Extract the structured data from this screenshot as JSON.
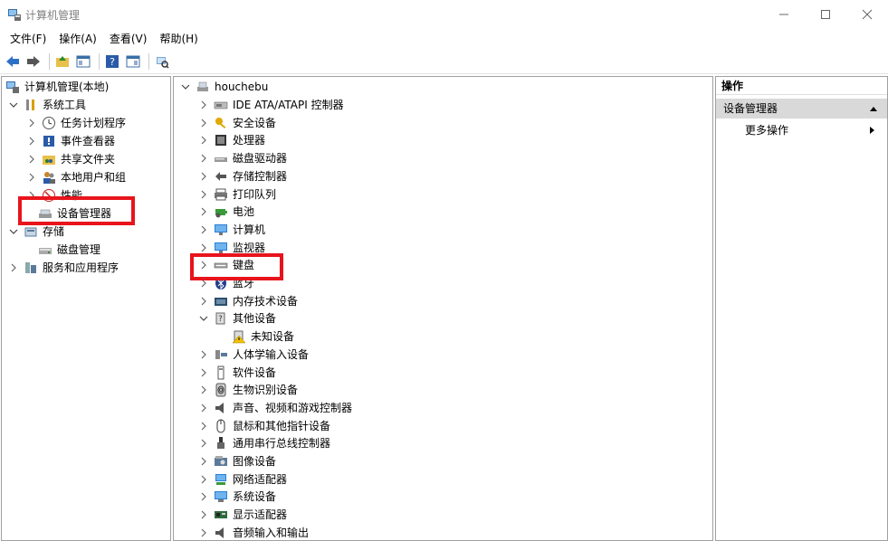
{
  "window": {
    "title": "计算机管理"
  },
  "menu": [
    "文件(F)",
    "操作(A)",
    "查看(V)",
    "帮助(H)"
  ],
  "left_tree": [
    {
      "label": "计算机管理(本地)",
      "level": 0,
      "expander": "",
      "icon": "computer-management-icon"
    },
    {
      "label": "系统工具",
      "level": 1,
      "expander": "expanded",
      "icon": "tools-icon"
    },
    {
      "label": "任务计划程序",
      "level": 2,
      "expander": "collapsed",
      "icon": "clock-icon"
    },
    {
      "label": "事件查看器",
      "level": 2,
      "expander": "collapsed",
      "icon": "event-viewer-icon"
    },
    {
      "label": "共享文件夹",
      "level": 2,
      "expander": "collapsed",
      "icon": "shared-folder-icon"
    },
    {
      "label": "本地用户和组",
      "level": 2,
      "expander": "collapsed",
      "icon": "users-icon"
    },
    {
      "label": "性能",
      "level": 2,
      "expander": "collapsed",
      "icon": "performance-icon"
    },
    {
      "label": "设备管理器",
      "level": 2,
      "expander": "",
      "icon": "device-manager-icon"
    },
    {
      "label": "存储",
      "level": 1,
      "expander": "expanded",
      "icon": "storage-icon"
    },
    {
      "label": "磁盘管理",
      "level": 2,
      "expander": "",
      "icon": "disk-management-icon"
    },
    {
      "label": "服务和应用程序",
      "level": 1,
      "expander": "collapsed",
      "icon": "services-icon"
    }
  ],
  "device_tree": [
    {
      "label": "houchebu",
      "level": 0,
      "expander": "expanded",
      "icon": "computer-icon"
    },
    {
      "label": "IDE ATA/ATAPI 控制器",
      "level": 1,
      "expander": "collapsed",
      "icon": "ide-controller-icon"
    },
    {
      "label": "安全设备",
      "level": 1,
      "expander": "collapsed",
      "icon": "key-icon"
    },
    {
      "label": "处理器",
      "level": 1,
      "expander": "collapsed",
      "icon": "processor-icon"
    },
    {
      "label": "磁盘驱动器",
      "level": 1,
      "expander": "collapsed",
      "icon": "disk-drive-icon"
    },
    {
      "label": "存储控制器",
      "level": 1,
      "expander": "collapsed",
      "icon": "storage-controller-icon"
    },
    {
      "label": "打印队列",
      "level": 1,
      "expander": "collapsed",
      "icon": "printer-icon"
    },
    {
      "label": "电池",
      "level": 1,
      "expander": "collapsed",
      "icon": "battery-icon"
    },
    {
      "label": "计算机",
      "level": 1,
      "expander": "collapsed",
      "icon": "monitor-icon"
    },
    {
      "label": "监视器",
      "level": 1,
      "expander": "collapsed",
      "icon": "monitor-icon"
    },
    {
      "label": "键盘",
      "level": 1,
      "expander": "collapsed",
      "icon": "keyboard-icon"
    },
    {
      "label": "蓝牙",
      "level": 1,
      "expander": "collapsed",
      "icon": "bluetooth-icon"
    },
    {
      "label": "内存技术设备",
      "level": 1,
      "expander": "collapsed",
      "icon": "memory-icon"
    },
    {
      "label": "其他设备",
      "level": 1,
      "expander": "expanded",
      "icon": "other-devices-icon"
    },
    {
      "label": "未知设备",
      "level": 2,
      "expander": "",
      "icon": "unknown-device-warning-icon"
    },
    {
      "label": "人体学输入设备",
      "level": 1,
      "expander": "collapsed",
      "icon": "hid-icon"
    },
    {
      "label": "软件设备",
      "level": 1,
      "expander": "collapsed",
      "icon": "software-device-icon"
    },
    {
      "label": "生物识别设备",
      "level": 1,
      "expander": "collapsed",
      "icon": "fingerprint-icon"
    },
    {
      "label": "声音、视频和游戏控制器",
      "level": 1,
      "expander": "collapsed",
      "icon": "speaker-icon"
    },
    {
      "label": "鼠标和其他指针设备",
      "level": 1,
      "expander": "collapsed",
      "icon": "mouse-icon"
    },
    {
      "label": "通用串行总线控制器",
      "level": 1,
      "expander": "collapsed",
      "icon": "usb-icon"
    },
    {
      "label": "图像设备",
      "level": 1,
      "expander": "collapsed",
      "icon": "camera-icon"
    },
    {
      "label": "网络适配器",
      "level": 1,
      "expander": "collapsed",
      "icon": "network-adapter-icon"
    },
    {
      "label": "系统设备",
      "level": 1,
      "expander": "collapsed",
      "icon": "system-devices-icon"
    },
    {
      "label": "显示适配器",
      "level": 1,
      "expander": "collapsed",
      "icon": "display-adapter-icon"
    },
    {
      "label": "音频输入和输出",
      "level": 1,
      "expander": "collapsed",
      "icon": "audio-io-icon"
    }
  ],
  "actions": {
    "header": "操作",
    "selected": "设备管理器",
    "more": "更多操作"
  },
  "colors": {
    "highlight_box": "#e8141c",
    "pane_border": "#a0a0a0",
    "action_selected_bg": "#d9d9d9"
  }
}
